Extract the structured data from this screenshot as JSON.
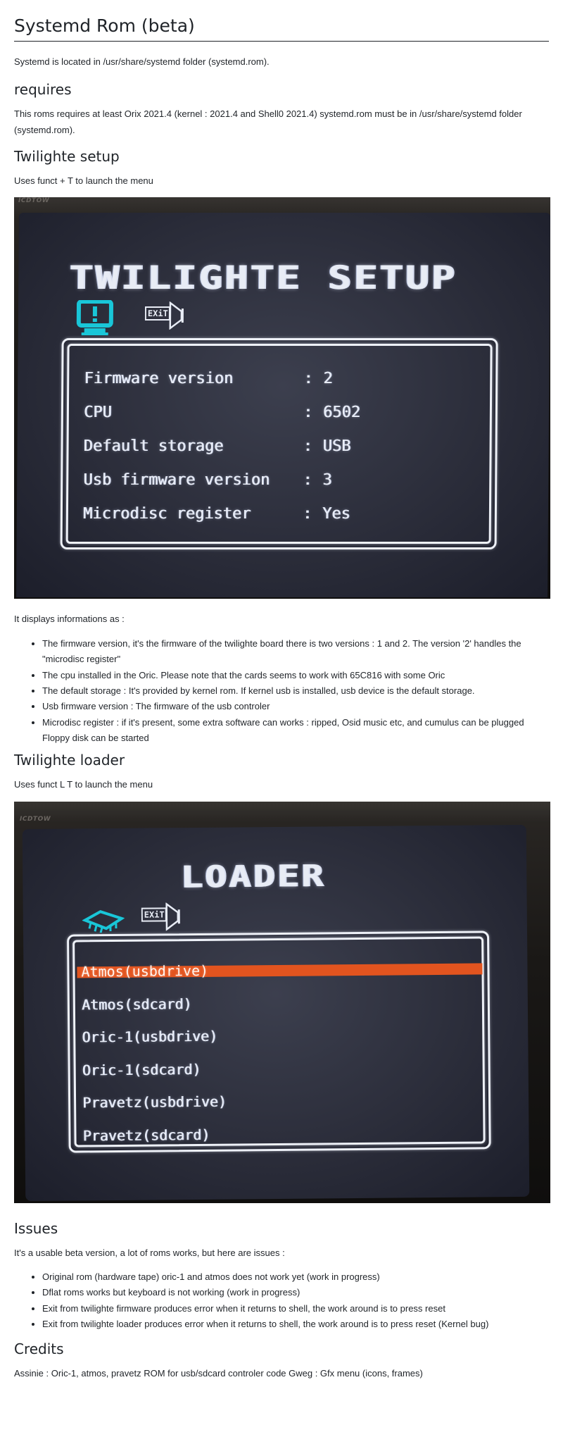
{
  "title": "Systemd Rom (beta)",
  "intro": "Systemd is located in /usr/share/systemd folder (systemd.rom).",
  "requires": {
    "heading": "requires",
    "text": "This roms requires at least Orix 2021.4 (kernel : 2021.4 and Shell0 2021.4) systemd.rom must be in /usr/share/systemd folder (systemd.rom)."
  },
  "setup": {
    "heading": "Twilighte setup",
    "usage": "Uses funct + T to launch the menu",
    "screen": {
      "brand": "ICDTOW",
      "title": "TWILIGHTE SETUP",
      "exit_label": "EXiT",
      "rows": [
        {
          "label": "Firmware version",
          "sep": ":",
          "value": "2"
        },
        {
          "label": "CPU",
          "sep": ":",
          "value": "6502"
        },
        {
          "label": "Default storage",
          "sep": ":",
          "value": "USB"
        },
        {
          "label": "Usb firmware version",
          "sep": ":",
          "value": "3"
        },
        {
          "label": "Microdisc register",
          "sep": ":",
          "value": "Yes"
        }
      ],
      "accent": "#19c6d8",
      "exit_color": "#e8ecf5"
    },
    "displays_intro": "It displays informations as :",
    "items": [
      "The firmware version, it's the firmware of the twilighte board there is two versions : 1 and 2. The version '2' handles the \"microdisc register\"",
      "The cpu installed in the Oric. Please note that the cards seems to work with 65C816 with some Oric",
      "The default storage : It's provided by kernel rom. If kernel usb is installed, usb device is the default storage.",
      "Usb firmware version : The firmware of the usb controler",
      "Microdisc register : if it's present, some extra software can works : ripped, Osid music etc, and cumulus can be plugged Floppy disk can be started"
    ]
  },
  "loader": {
    "heading": "Twilighte loader",
    "usage": "Uses funct L T to launch the menu",
    "screen": {
      "brand": "ICDTOW",
      "title": "LOADER",
      "exit_label": "EXiT",
      "rows": [
        "Atmos(usbdrive)",
        "Atmos(sdcard)",
        "Oric-1(usbdrive)",
        "Oric-1(sdcard)",
        "Pravetz(usbdrive)",
        "Pravetz(sdcard)"
      ],
      "selected_index": 0,
      "selected_color": "#e2541f",
      "accent": "#19c6d8"
    }
  },
  "issues": {
    "heading": "Issues",
    "intro": "It's a usable beta version, a lot of roms works, but here are issues :",
    "items": [
      "Original rom (hardware tape) oric-1 and atmos does not work yet (work in progress)",
      "Dflat roms works but keyboard is not working (work in progress)",
      "Exit from twilighte firmware produces error when it returns to shell, the work around is to press reset",
      "Exit from twilighte loader produces error when it returns to shell, the work around is to press reset (Kernel bug)"
    ]
  },
  "credits": {
    "heading": "Credits",
    "text": "Assinie : Oric-1, atmos, pravetz ROM for usb/sdcard controler code Gweg : Gfx menu (icons, frames)"
  }
}
